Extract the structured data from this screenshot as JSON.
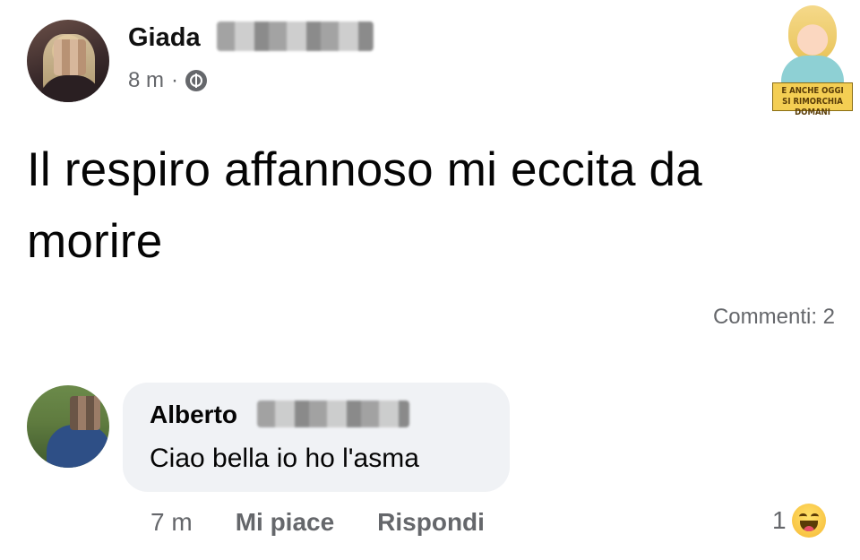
{
  "post": {
    "author": "Giada",
    "time": "8 m",
    "separator": "·",
    "audience_icon": "globe-icon",
    "text": "Il respiro affannoso mi eccita da morire",
    "comments_count": "Commenti: 2"
  },
  "watermark": {
    "text_line1": "E ANCHE OGGI",
    "text_line2": "SI RIMORCHIA DOMANI"
  },
  "comment": {
    "author": "Alberto",
    "text": "Ciao bella io ho l'asma",
    "time": "7 m",
    "like_label": "Mi piace",
    "reply_label": "Rispondi",
    "reaction_count": "1",
    "reaction_icon": "haha-reaction-icon"
  },
  "colors": {
    "secondary_text": "#65676b",
    "bubble_bg": "#f0f2f5"
  }
}
